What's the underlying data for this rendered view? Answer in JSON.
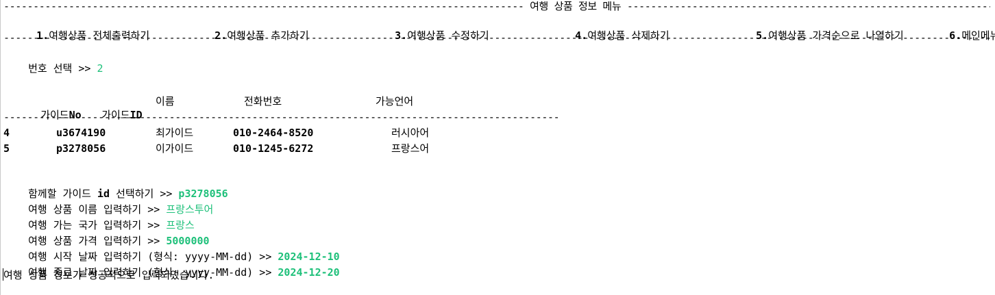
{
  "menu": {
    "title_rule": "---------------------------------------------------------------------------------------- 여행 상품 정보 메뉴 ----------------------------------------------------------------------------------------",
    "items": [
      {
        "num": "1.",
        "label": "여행상품 전체출력하기"
      },
      {
        "num": "2.",
        "label": "여행상품 추가하기"
      },
      {
        "num": "3.",
        "label": "여행상품 수정하기"
      },
      {
        "num": "4.",
        "label": "여행상품 삭제하기"
      },
      {
        "num": "5.",
        "label": "여행상품 가격순으로 나열하기"
      },
      {
        "num": "6.",
        "label": "메인메뉴"
      }
    ],
    "bottom_rule": "------------------------------------------------------------------------------------------------------------------------------------------------------------------------------------------------------"
  },
  "select_prompt": {
    "label": "번호 선택 >> ",
    "value": "2"
  },
  "guide_table": {
    "headers": {
      "no_prefix": "가이드",
      "no_suffix": "No",
      "id_prefix": "가이드",
      "id_suffix": "ID",
      "name": "이름",
      "phone": "전화번호",
      "language": "가능언어"
    },
    "rule": "----------------------------------------------------------------------------------------------",
    "rows": [
      {
        "no": "4",
        "id": "u3674190",
        "name": "최가이드",
        "phone": "010-2464-8520",
        "language": "러시아어"
      },
      {
        "no": "5",
        "id": "p3278056",
        "name": "이가이드",
        "phone": "010-1245-6272",
        "language": "프랑스어"
      }
    ]
  },
  "inputs": [
    {
      "prompt_a": "함께할 가이드 ",
      "prompt_b": "id",
      "prompt_c": " 선택하기 >> ",
      "value": "p3278056"
    },
    {
      "prompt_a": "여행 상품 이름 입력하기 >> ",
      "value": "프랑스투어"
    },
    {
      "prompt_a": "여행 가는 국가 입력하기 >> ",
      "value": "프랑스"
    },
    {
      "prompt_a": "여행 상품 가격 입력하기 >> ",
      "value": "5000000"
    },
    {
      "prompt_a": "여행 시작 날짜 입력하기 (형식: yyyy-MM-dd) >> ",
      "value": "2024-12-10"
    },
    {
      "prompt_a": "여행 종료 날짜 입력하기 (형식: yyyy-MM-dd) >> ",
      "value": "2024-12-20"
    }
  ],
  "result_message": "여행 상품 정보가 성공적으로 입력되었습니다."
}
